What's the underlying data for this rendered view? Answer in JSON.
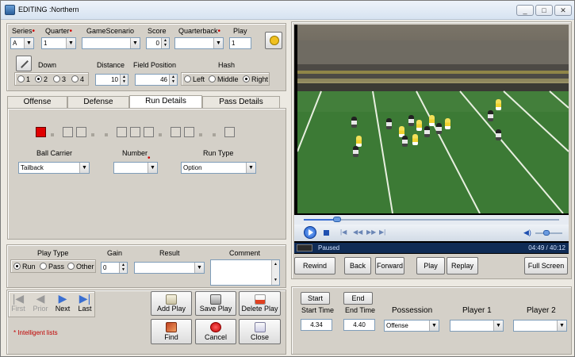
{
  "window": {
    "title": "EDITING :Northern",
    "controls": [
      "_",
      "□",
      "✕"
    ]
  },
  "play_header": {
    "series_label": "Series",
    "series_value": "A",
    "quarter_label": "Quarter",
    "quarter_value": "1",
    "scenario_label": "GameScenario",
    "scenario_value": "",
    "score_label": "Score",
    "score_value": "0",
    "qb_label": "Quarterback",
    "qb_value": "",
    "play_label": "Play",
    "play_value": "1",
    "down_label": "Down",
    "down_options": [
      "1",
      "2",
      "3",
      "4"
    ],
    "down_selected": "2",
    "distance_label": "Distance",
    "distance_value": "10",
    "fieldpos_label": "Field Position",
    "fieldpos_value": "46",
    "hash_label": "Hash",
    "hash_options": [
      "Left",
      "Middle",
      "Right"
    ],
    "hash_selected": "Right"
  },
  "tabs": [
    "Offense",
    "Defense",
    "Run Details",
    "Pass Details"
  ],
  "active_tab": "Run Details",
  "run_details": {
    "ball_carrier_label": "Ball Carrier",
    "ball_carrier_value": "Tailback",
    "number_label": "Number",
    "number_value": "",
    "run_type_label": "Run Type",
    "run_type_value": "Option",
    "gap_selected_index": 0
  },
  "result": {
    "play_type_label": "Play Type",
    "play_type_options": [
      "Run",
      "Pass",
      "Other"
    ],
    "play_type_selected": "Run",
    "gain_label": "Gain",
    "gain_value": "0",
    "result_label": "Result",
    "result_value": "",
    "comment_label": "Comment",
    "comment_value": ""
  },
  "nav": {
    "first": "First",
    "prior": "Prior",
    "next": "Next",
    "last": "Last"
  },
  "actions": {
    "add_play": "Add Play",
    "save_play": "Save Play",
    "delete_play": "Delete Play",
    "find": "Find",
    "cancel": "Cancel",
    "close": "Close"
  },
  "footnote": "* Intelligent lists",
  "player": {
    "status": "Paused",
    "time": "04:49 / 40:12",
    "progress": 0.13,
    "volume": 0.4
  },
  "playback": {
    "rewind": "Rewind",
    "back": "Back",
    "forward": "Forward",
    "play": "Play",
    "replay": "Replay",
    "fullscreen": "Full Screen"
  },
  "clip": {
    "start_button": "Start",
    "end_button": "End",
    "start_time_label": "Start Time",
    "start_time_value": "4.34",
    "end_time_label": "End Time",
    "end_time_value": "4.40",
    "possession_label": "Possession",
    "possession_value": "Offense",
    "player1_label": "Player 1",
    "player1_value": "",
    "player2_label": "Player 2",
    "player2_value": ""
  },
  "colors": {
    "accent_red": "#e00000",
    "footnote_red": "#c00000",
    "field_green": "#3c7a35"
  }
}
